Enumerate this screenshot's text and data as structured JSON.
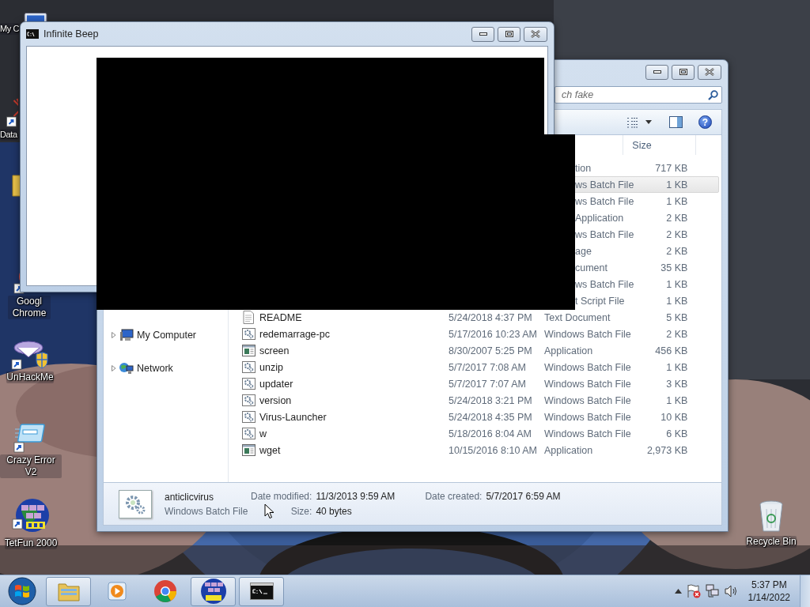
{
  "desktop": {
    "icons": [
      {
        "label": "My C",
        "kind": "computer"
      },
      {
        "label": "Data",
        "kind": "data"
      },
      {
        "kind": "folder"
      },
      {
        "label": "Googl Chrome",
        "kind": "browser"
      },
      {
        "label": "UnHackMe",
        "kind": "shield"
      },
      {
        "label": "Crazy Error V2",
        "kind": "window"
      },
      {
        "label": "TetFun 2000",
        "kind": "blocks"
      },
      {
        "label": "Recycle Bin",
        "kind": "bin"
      }
    ]
  },
  "explorer": {
    "search": {
      "placeholder": "ch fake"
    },
    "toolbar": {
      "help": "?"
    },
    "columns": [
      {
        "label": "Size"
      }
    ],
    "nav": [
      {
        "label": "My Computer",
        "kind": "computer"
      },
      {
        "label": "Network",
        "kind": "network"
      }
    ],
    "rows": [
      {
        "type": "tion",
        "size": "717 KB",
        "selected": false
      },
      {
        "type": "ws Batch File",
        "size": "1 KB",
        "selected": true
      },
      {
        "type": "ws Batch File",
        "size": "1 KB",
        "selected": false
      },
      {
        "type": "Application",
        "size": "2 KB",
        "selected": false
      },
      {
        "type": "ws Batch File",
        "size": "2 KB",
        "selected": false
      },
      {
        "type": "age",
        "size": "2 KB",
        "selected": false
      },
      {
        "type": "cument",
        "size": "35 KB",
        "selected": false
      },
      {
        "type": "ws Batch File",
        "size": "1 KB",
        "selected": false
      },
      {
        "type": "t Script File",
        "size": "1 KB",
        "selected": false
      },
      {
        "kind": "text",
        "name": "README",
        "date": "5/24/2018 4:37 PM",
        "type": "Text Document",
        "size": "5 KB",
        "selected": false
      },
      {
        "kind": "batch",
        "name": "redemarrage-pc",
        "date": "5/17/2016 10:23 AM",
        "type": "Windows Batch File",
        "size": "2 KB",
        "selected": false
      },
      {
        "kind": "app",
        "name": "screen",
        "date": "8/30/2007 5:25 PM",
        "type": "Application",
        "size": "456 KB",
        "selected": false
      },
      {
        "kind": "batch",
        "name": "unzip",
        "date": "5/7/2017 7:08 AM",
        "type": "Windows Batch File",
        "size": "1 KB",
        "selected": false
      },
      {
        "kind": "batch",
        "name": "updater",
        "date": "5/7/2017 7:07 AM",
        "type": "Windows Batch File",
        "size": "3 KB",
        "selected": false
      },
      {
        "kind": "batch",
        "name": "version",
        "date": "5/24/2018 3:21 PM",
        "type": "Windows Batch File",
        "size": "1 KB",
        "selected": false
      },
      {
        "kind": "batch",
        "name": "Virus-Launcher",
        "date": "5/24/2018 4:35 PM",
        "type": "Windows Batch File",
        "size": "10 KB",
        "selected": false
      },
      {
        "kind": "batch",
        "name": "w",
        "date": "5/18/2016 8:04 AM",
        "type": "Windows Batch File",
        "size": "6 KB",
        "selected": false
      },
      {
        "kind": "app",
        "name": "wget",
        "date": "10/15/2016 8:10 AM",
        "type": "Application",
        "size": "2,973 KB",
        "selected": false
      }
    ],
    "details": {
      "name": "anticlicvirus",
      "type": "Windows Batch File",
      "fields": [
        {
          "label": "Date modified:",
          "value": "11/3/2013 9:59 AM"
        },
        {
          "label": "Size:",
          "value": "40 bytes"
        },
        {
          "label": "Date created:",
          "value": "5/7/2017 6:59 AM"
        }
      ]
    }
  },
  "console_window": {
    "title": "Infinite Beep"
  },
  "taskbar": {
    "apps": [
      {
        "kind": "explorer",
        "running": true
      },
      {
        "kind": "media",
        "running": false
      },
      {
        "kind": "browser",
        "running": false
      },
      {
        "kind": "blocks",
        "running": true
      },
      {
        "kind": "terminal",
        "running": true
      }
    ],
    "clock": {
      "time": "5:37 PM",
      "date": "1/14/2022"
    }
  }
}
